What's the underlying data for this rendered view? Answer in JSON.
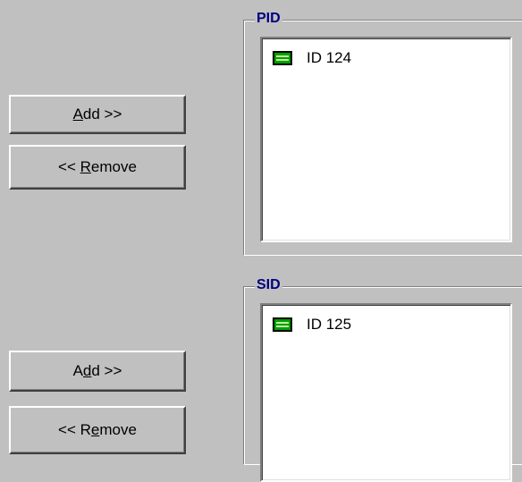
{
  "pid_group": {
    "legend": "PID",
    "items": [
      {
        "label": "ID 124",
        "icon": "list-entry-icon"
      }
    ],
    "add_button": {
      "prefix": "",
      "mnemonic": "A",
      "suffix": "dd >>"
    },
    "remove_button": {
      "prefix": "<< ",
      "mnemonic": "R",
      "suffix": "emove"
    }
  },
  "sid_group": {
    "legend": "SID",
    "items": [
      {
        "label": "ID 125",
        "icon": "list-entry-icon"
      }
    ],
    "add_button": {
      "prefix": "A",
      "mnemonic": "d",
      "suffix": "d >>"
    },
    "remove_button": {
      "prefix": "<< R",
      "mnemonic": "e",
      "suffix": "move"
    }
  },
  "colors": {
    "face": "#c0c0c0",
    "legend": "#000080",
    "icon": "#00a000"
  }
}
